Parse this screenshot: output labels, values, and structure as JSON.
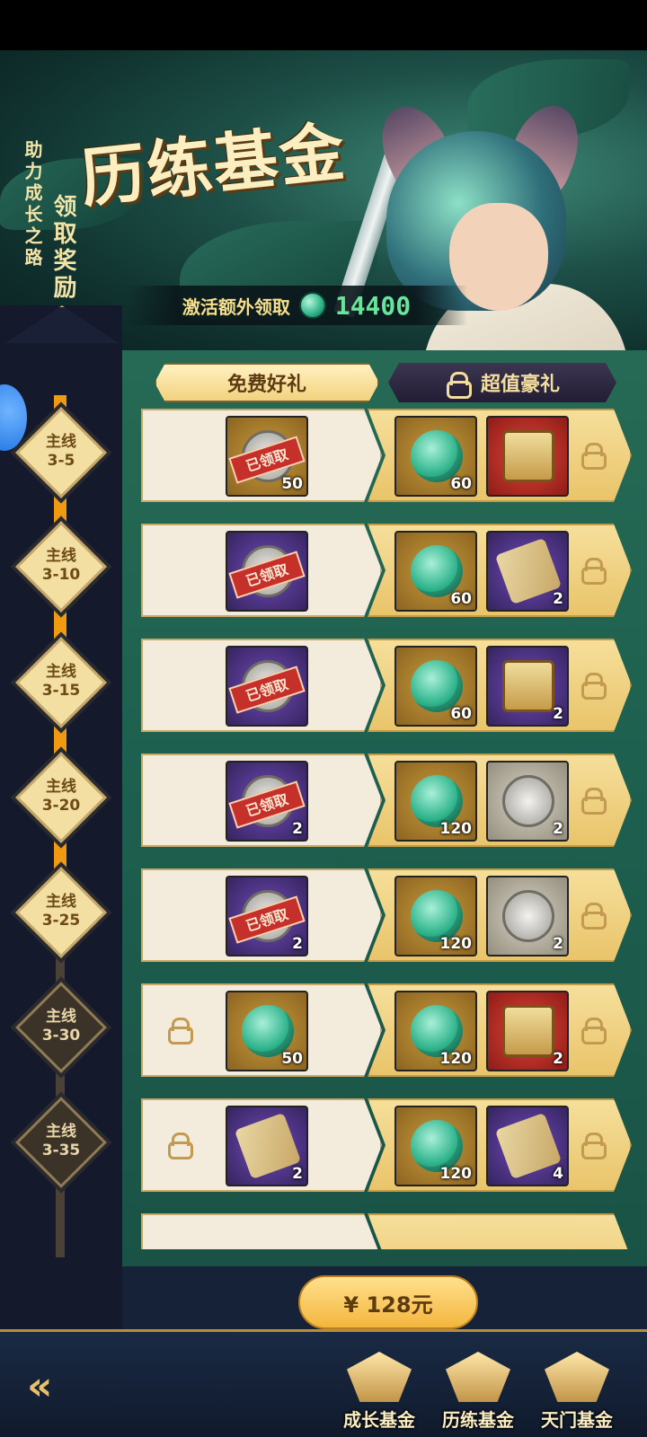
{
  "banner": {
    "slogan_line1": "助力成长之路",
    "slogan_line2": "领取奖励",
    "title": "历练基金",
    "bonus_label": "激活额外领取",
    "bonus_value": "14400"
  },
  "tabs": {
    "free_label": "免费好礼",
    "premium_label": "超值豪礼"
  },
  "stages": [
    {
      "line1": "主线",
      "line2": "3-5",
      "unlocked": true
    },
    {
      "line1": "主线",
      "line2": "3-10",
      "unlocked": true
    },
    {
      "line1": "主线",
      "line2": "3-15",
      "unlocked": true
    },
    {
      "line1": "主线",
      "line2": "3-20",
      "unlocked": true
    },
    {
      "line1": "主线",
      "line2": "3-25",
      "unlocked": true
    },
    {
      "line1": "主线",
      "line2": "3-30",
      "unlocked": false
    },
    {
      "line1": "主线",
      "line2": "3-35",
      "unlocked": false
    }
  ],
  "rows": [
    {
      "free_qty": "50",
      "claimed_text": "已领取",
      "prem1_qty": "60",
      "prem2_qty": ""
    },
    {
      "free_qty": "",
      "claimed_text": "已领取",
      "prem1_qty": "60",
      "prem2_qty": "2"
    },
    {
      "free_qty": "",
      "claimed_text": "已领取",
      "prem1_qty": "60",
      "prem2_qty": "2"
    },
    {
      "free_qty": "2",
      "claimed_text": "已领取",
      "prem1_qty": "120",
      "prem2_qty": "2"
    },
    {
      "free_qty": "2",
      "claimed_text": "已领取",
      "prem1_qty": "120",
      "prem2_qty": "2"
    },
    {
      "free_qty": "50",
      "claimed_text": "",
      "prem1_qty": "120",
      "prem2_qty": "2"
    },
    {
      "free_qty": "2",
      "claimed_text": "",
      "prem1_qty": "120",
      "prem2_qty": "4"
    }
  ],
  "purchase": {
    "price_label": "¥ 128元"
  },
  "bottom_nav": {
    "back_glyph": "«",
    "items": [
      "成长基金",
      "历练基金",
      "天门基金"
    ]
  }
}
